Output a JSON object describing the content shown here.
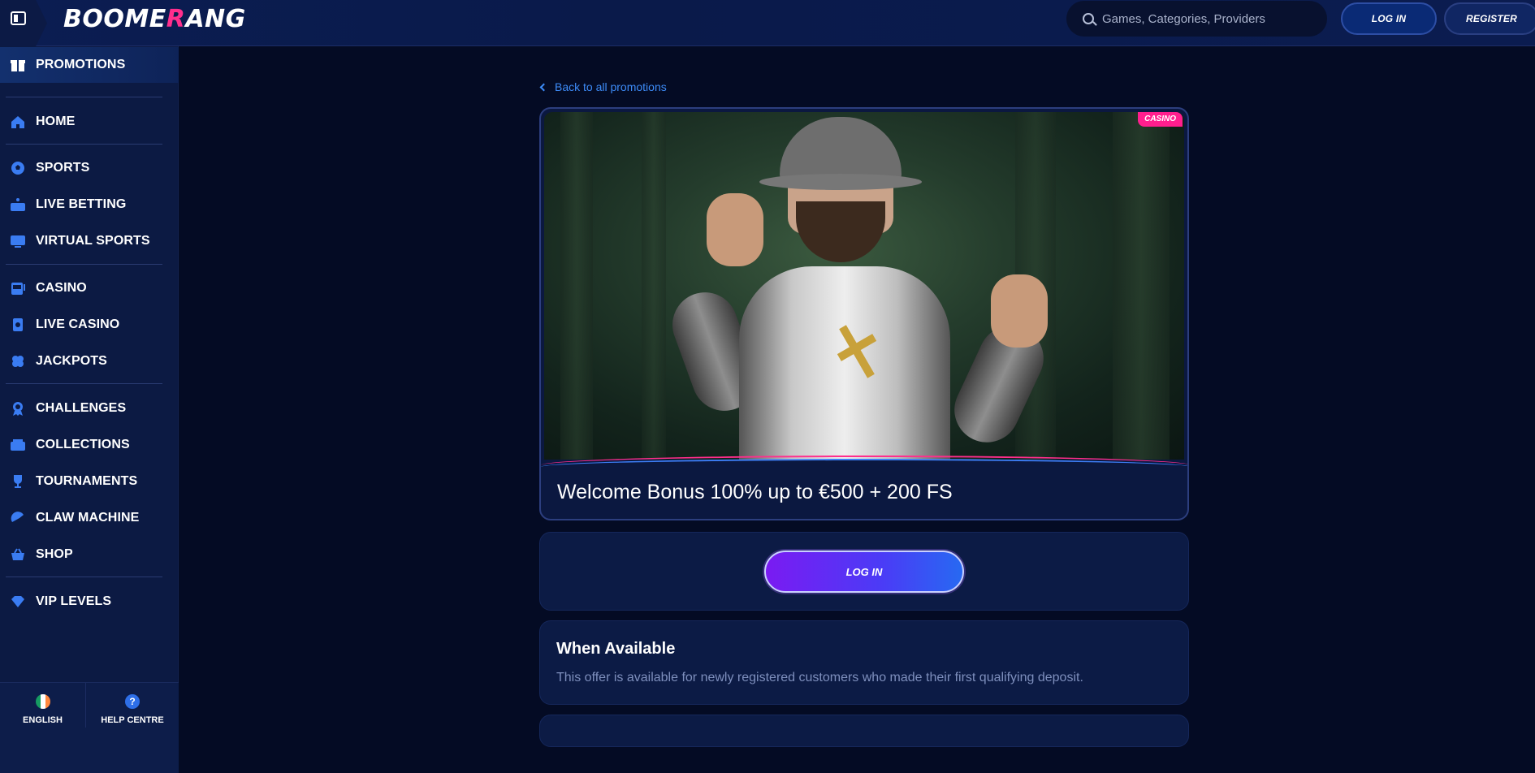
{
  "header": {
    "logo_text_a": "BOOME",
    "logo_text_k": "R",
    "logo_text_b": "ANG",
    "search_placeholder": "Games, Categories, Providers",
    "login_label": "LOG IN",
    "register_label": "REGISTER"
  },
  "sidebar": {
    "items": [
      {
        "label": "PROMOTIONS",
        "icon": "gift-icon"
      },
      {
        "label": "HOME",
        "icon": "home-icon"
      },
      {
        "label": "SPORTS",
        "icon": "soccer-ball-icon"
      },
      {
        "label": "LIVE BETTING",
        "icon": "live-icon"
      },
      {
        "label": "VIRTUAL SPORTS",
        "icon": "monitor-icon"
      },
      {
        "label": "CASINO",
        "icon": "slot-machine-icon"
      },
      {
        "label": "LIVE CASINO",
        "icon": "cards-icon"
      },
      {
        "label": "JACKPOTS",
        "icon": "clover-icon"
      },
      {
        "label": "CHALLENGES",
        "icon": "medal-icon"
      },
      {
        "label": "COLLECTIONS",
        "icon": "collection-icon"
      },
      {
        "label": "TOURNAMENTS",
        "icon": "trophy-icon"
      },
      {
        "label": "CLAW MACHINE",
        "icon": "claw-icon"
      },
      {
        "label": "SHOP",
        "icon": "basket-icon"
      },
      {
        "label": "VIP LEVELS",
        "icon": "diamond-icon"
      }
    ],
    "language_label": "ENGLISH",
    "help_label": "HELP CENTRE",
    "help_glyph": "?"
  },
  "main": {
    "back_link": "Back to all promotions",
    "tag": "CASINO",
    "promo_title": "Welcome Bonus 100% up to €500 + 200 FS",
    "login_button": "LOG IN",
    "availability_title": "When Available",
    "availability_text": "This offer is available for newly registered customers who made their first qualifying deposit."
  },
  "colors": {
    "accent_blue": "#3d8bf7",
    "brand_pink": "#ff2e8d",
    "background": "#040b24"
  }
}
